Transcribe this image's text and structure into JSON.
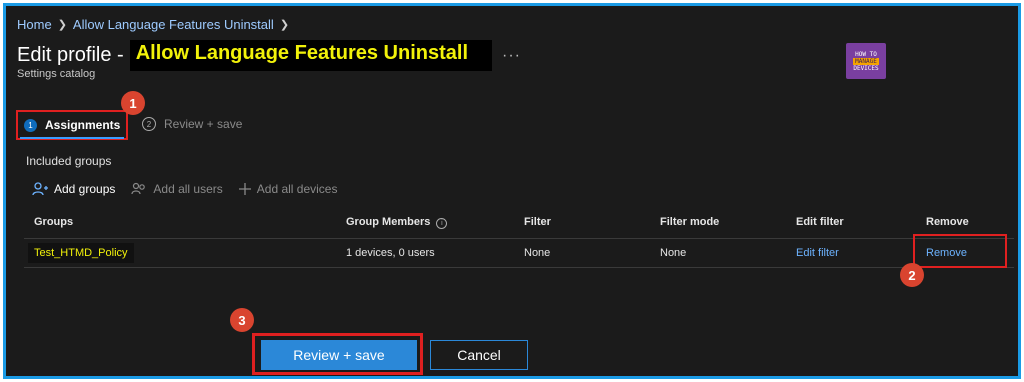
{
  "breadcrumb": {
    "home": "Home",
    "current": "Allow Language Features Uninstall"
  },
  "header": {
    "title_prefix": "Edit profile -",
    "title_highlight": "Allow Language Features Uninstall",
    "more": "···",
    "subtitle": "Settings catalog"
  },
  "logo": {
    "line1": "HOW TO",
    "line2": "MANAGE",
    "line3": "DEVICES"
  },
  "wizard": {
    "steps": [
      {
        "number": "1",
        "label": "Assignments",
        "active": true
      },
      {
        "number": "2",
        "label": "Review + save",
        "active": false
      }
    ]
  },
  "annotations": {
    "badge1": "1",
    "badge2": "2",
    "badge3": "3"
  },
  "section": {
    "included_groups": "Included groups"
  },
  "toolbar": {
    "add_groups": "Add groups",
    "add_all_users": "Add all users",
    "add_all_devices": "Add all devices"
  },
  "table": {
    "headers": [
      "Groups",
      "Group Members",
      "Filter",
      "Filter mode",
      "Edit filter",
      "Remove"
    ],
    "rows": [
      {
        "group": "Test_HTMD_Policy",
        "members": "1 devices, 0 users",
        "filter": "None",
        "filter_mode": "None",
        "edit_filter": "Edit filter",
        "remove": "Remove"
      }
    ]
  },
  "footer": {
    "review_save": "Review + save",
    "cancel": "Cancel"
  },
  "colors": {
    "background": "#1b1b1b",
    "accent": "#2b88d8",
    "link": "#6db3ff",
    "highlight_text": "#f2f20a",
    "annotation_red": "#e02020",
    "badge": "#d9442f",
    "frame": "#1a9be6"
  }
}
